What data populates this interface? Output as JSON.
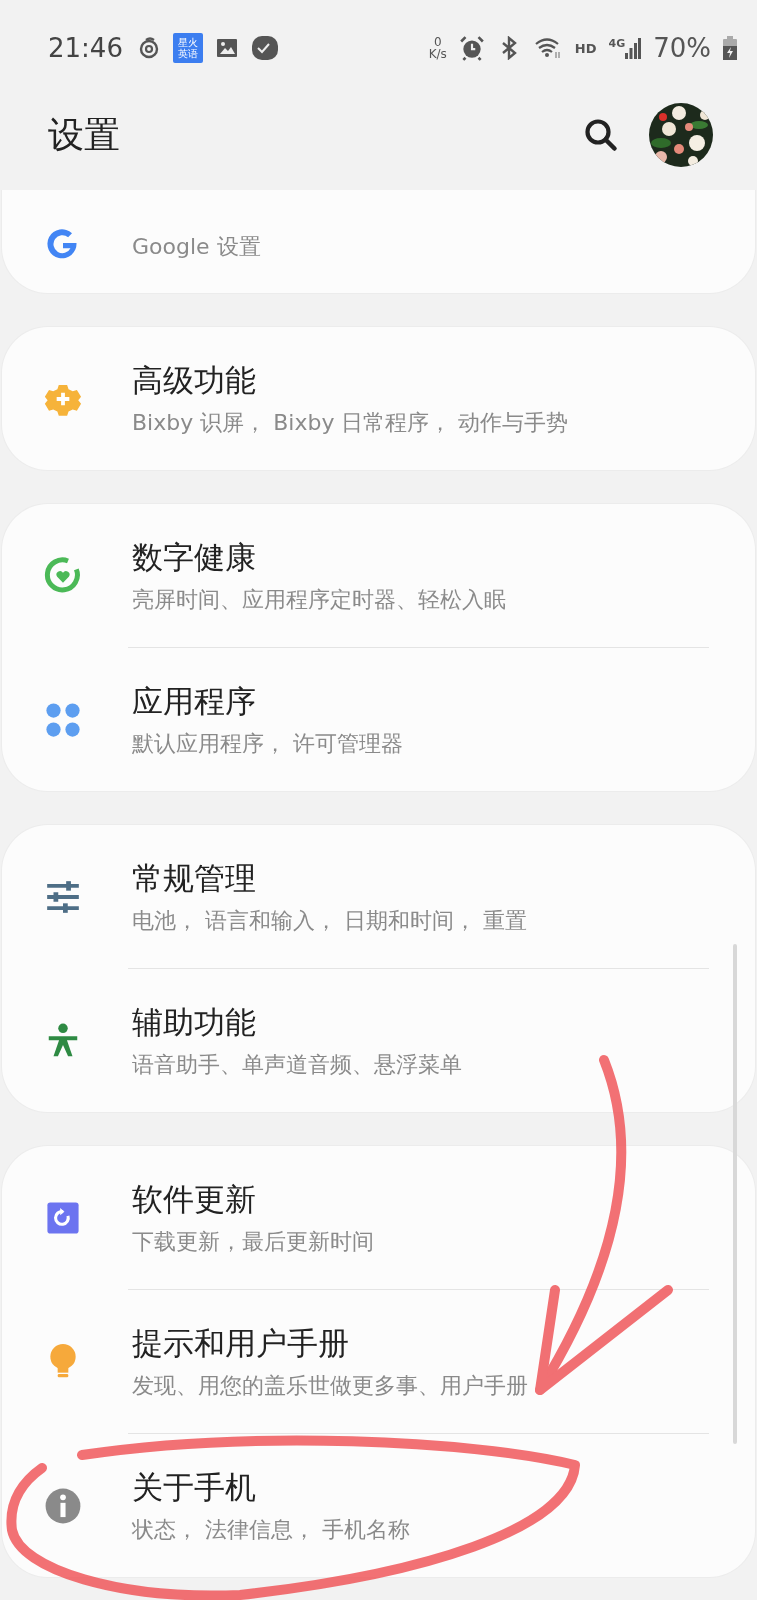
{
  "status_bar": {
    "time": "21:46",
    "app_badge": [
      "星火",
      "英语"
    ],
    "speed_value": "0",
    "speed_unit": "K/s",
    "hd": "HD",
    "network": "4G",
    "battery": "70%"
  },
  "header": {
    "title": "设置"
  },
  "cards": [
    {
      "items": [
        {
          "summary": "Google 设置"
        }
      ]
    },
    {
      "items": [
        {
          "title": "高级功能",
          "summary": "Bixby 识屏， Bixby 日常程序， 动作与手势"
        }
      ]
    },
    {
      "items": [
        {
          "title": "数字健康",
          "summary": "亮屏时间、应用程序定时器、轻松入眠"
        },
        {
          "title": "应用程序",
          "summary": "默认应用程序， 许可管理器"
        }
      ]
    },
    {
      "items": [
        {
          "title": "常规管理",
          "summary": "电池， 语言和输入， 日期和时间， 重置"
        },
        {
          "title": "辅助功能",
          "summary": "语音助手、单声道音频、悬浮菜单"
        }
      ]
    },
    {
      "items": [
        {
          "title": "软件更新",
          "summary": "下载更新，最后更新时间"
        },
        {
          "title": "提示和用户手册",
          "summary": "发现、用您的盖乐世做更多事、用户手册"
        },
        {
          "title": "关于手机",
          "summary": "状态， 法律信息， 手机名称"
        }
      ]
    }
  ]
}
